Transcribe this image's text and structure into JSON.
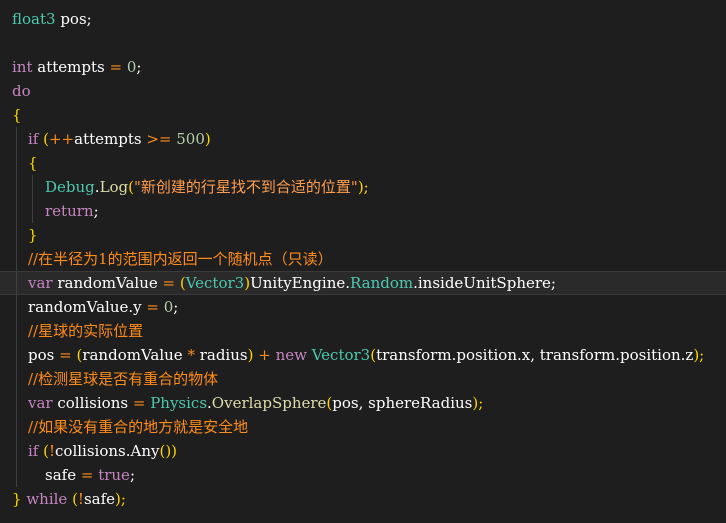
{
  "code": {
    "l1": {
      "t1": "float3",
      "t2": " pos;"
    },
    "l3": {
      "k": "int",
      "t": " attempts ",
      "o": "=",
      "n": " 0",
      "e": ";"
    },
    "l4": {
      "k": "do"
    },
    "l5": {
      "b": "{"
    },
    "l6": {
      "k": "if",
      "p1": " (",
      "op": "++",
      "t": "attempts ",
      "op2": ">=",
      "n": " 500",
      "p2": ")"
    },
    "l7": {
      "b": "{"
    },
    "l8": {
      "ty": "Debug",
      "t": ".",
      "fn": "Log",
      "p": "(",
      "s": "\"新创建的行星找不到合适的位置\"",
      "e": ");"
    },
    "l9": {
      "k": "return",
      "e": ";"
    },
    "l10": {
      "b": "}"
    },
    "l11": {
      "c": "//在半径为1的范围内返回一个随机点（只读）"
    },
    "l12": {
      "k": "var",
      "t": " randomValue ",
      "o": "=",
      "p": " (",
      "ty": "Vector3",
      "p2": ")",
      "t2": "UnityEngine.",
      "ty2": "Random",
      "t3": ".insideUnitSphere",
      "e": ";"
    },
    "l13": {
      "t": "randomValue.y ",
      "o": "=",
      "n": " 0",
      "e": ";"
    },
    "l14": {
      "c": "//星球的实际位置"
    },
    "l15": {
      "t": "pos ",
      "o": "=",
      "p": " (",
      "t2": "randomValue ",
      "o2": "*",
      "t3": " radius",
      "p2": ")",
      "o3": " +",
      "k": " new",
      "ty": " Vector3",
      "p3": "(",
      "t4": "transform.position.x, transform.position.z",
      "e": ");"
    },
    "l16": {
      "c": "//检测星球是否有重合的物体"
    },
    "l17": {
      "k": "var",
      "t": " collisions ",
      "o": "=",
      "ty": " Physics",
      "t2": ".",
      "fn": "OverlapSphere",
      "p": "(",
      "t3": "pos, sphereRadius",
      "e": ");"
    },
    "l18": {
      "c": "//如果没有重合的地方就是安全地"
    },
    "l19": {
      "k": "if",
      "p": " (",
      "o": "!",
      "t": "collisions.Any",
      "p2": "())"
    },
    "l20": {
      "t": "safe ",
      "o": "=",
      "k": " true",
      "e": ";"
    },
    "l21": {
      "b": "}",
      "k": " while",
      "p": " (",
      "o": "!",
      "t": "safe",
      "e": ");"
    }
  }
}
